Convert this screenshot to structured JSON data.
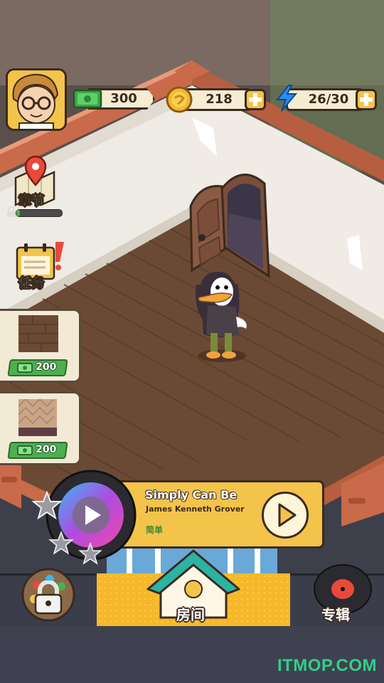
{
  "resources": {
    "cash": "300",
    "coins": "218",
    "energy": "26/30"
  },
  "sidebar": {
    "chapter_label": "章节",
    "chapter_progress": 0.08,
    "tasks_label": "任务"
  },
  "shop": {
    "items": [
      {
        "name": "wood-floor-item",
        "price": "200"
      },
      {
        "name": "pattern-wallpaper-item",
        "price": "200"
      }
    ]
  },
  "song": {
    "title": "Simply Can Be",
    "artist": "James Kenneth Grover",
    "difficulty": "简单",
    "stars_total": 3
  },
  "bottom_nav": {
    "room_label": "房间",
    "album_label": "专辑"
  },
  "watermark": "ITMOP.COM",
  "colors": {
    "accent_yellow": "#f4c34a",
    "nav_dark": "#3b3d4a",
    "cash_green": "#4caf50",
    "energy_blue": "#2a8cf0",
    "room_teal": "#2bb3a3"
  }
}
